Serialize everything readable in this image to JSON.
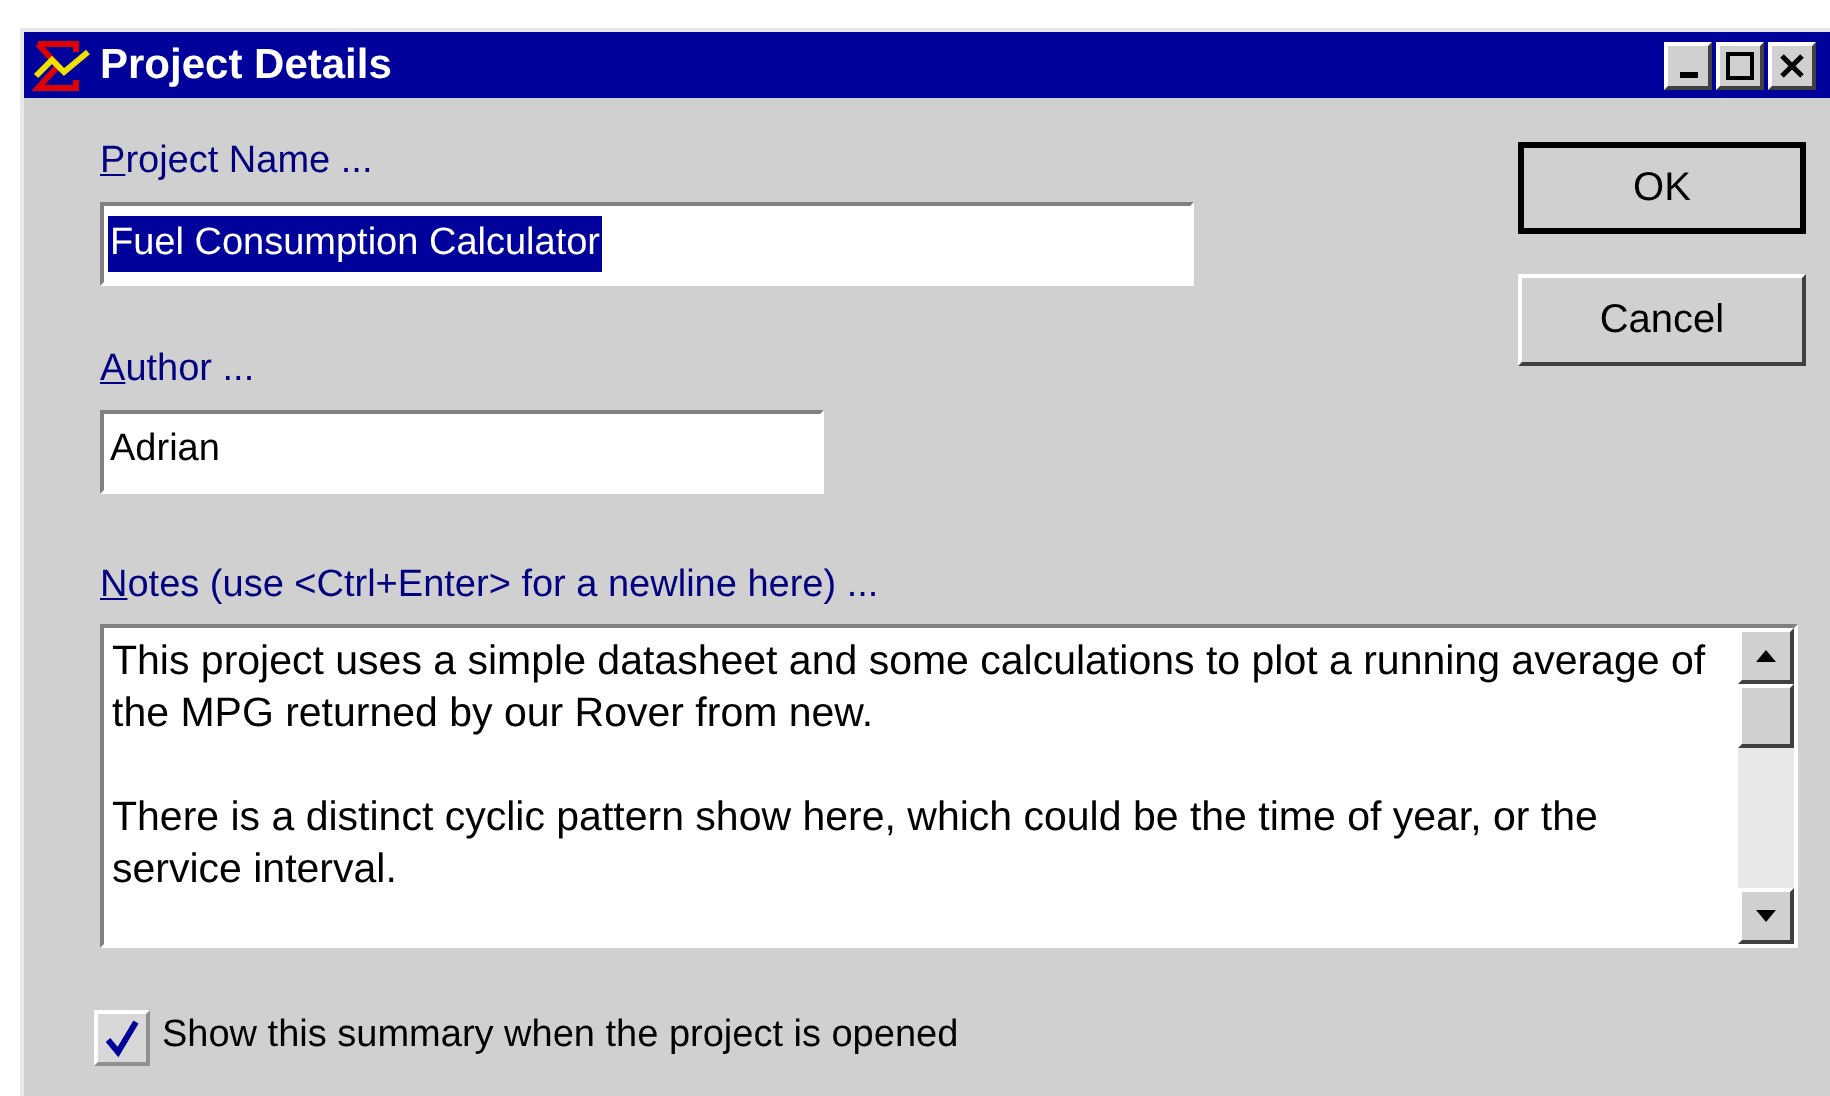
{
  "window": {
    "title": "Project Details"
  },
  "fields": [
    {
      "label": "Project Name ...",
      "underline_first": true,
      "value": "Fuel Consumption Calculator",
      "selected": true
    },
    {
      "label": "Author ...",
      "underline_first": true,
      "value": "Adrian",
      "selected": false
    }
  ],
  "notes": {
    "label": "Notes (use <Ctrl+Enter> for a newline here) ...",
    "underline_first": true,
    "paragraphs": [
      "This project uses a simple datasheet and some calculations to plot a running average of the MPG returned by our Rover from new.",
      "There is a distinct cyclic pattern show here, which could be the time of year, or the service interval."
    ]
  },
  "buttons": [
    {
      "label": "OK",
      "default": true
    },
    {
      "label": "Cancel",
      "default": false
    }
  ],
  "checkbox": {
    "label": "Show this summary when the project is opened",
    "checked": true
  }
}
